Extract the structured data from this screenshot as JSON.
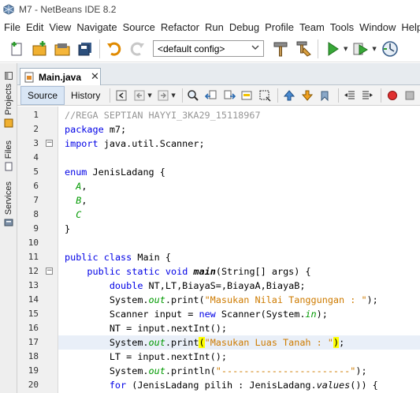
{
  "window": {
    "title": "M7 - NetBeans IDE 8.2"
  },
  "menu": [
    "File",
    "Edit",
    "View",
    "Navigate",
    "Source",
    "Refactor",
    "Run",
    "Debug",
    "Profile",
    "Team",
    "Tools",
    "Window",
    "Help"
  ],
  "toolbar": {
    "config_value": "<default config>"
  },
  "sidebar": {
    "tabs": [
      "Projects",
      "Files",
      "Services"
    ]
  },
  "editor": {
    "file_tab": "Main.java",
    "view_tabs": [
      "Source",
      "History"
    ],
    "line_numbers": [
      "1",
      "2",
      "3",
      "4",
      "5",
      "6",
      "7",
      "8",
      "9",
      "10",
      "11",
      "12",
      "13",
      "14",
      "15",
      "16",
      "17",
      "18",
      "19",
      "20"
    ],
    "lines": [
      "//REGA SEPTIAN HAYYI_3KA29_15118967",
      "package m7;",
      "import java.util.Scanner;",
      "",
      "enum JenisLadang {",
      "  A,",
      "  B,",
      "  C",
      "}",
      "",
      "public class Main {",
      "    public static void main(String[] args) {",
      "        double NT,LT,BiayaS=0,BiayaA,BiayaB;",
      "        System.out.print(\"Masukan Nilai Tanggungan : \");",
      "        Scanner input = new Scanner(System.in);",
      "        NT = input.nextInt();",
      "        System.out.print(\"Masukan Luas Tanah : \");",
      "        LT = input.nextInt();",
      "        System.out.println(\"-----------------------\");",
      "        for (JenisLadang pilih : JenisLadang.values()) {"
    ],
    "current_line": 17
  },
  "colors": {
    "keyword": "#0000e6",
    "comment": "#969696",
    "string": "#ce7b00",
    "field": "#009900",
    "current_line": "#e9eff8"
  },
  "icons": [
    "new-file-icon",
    "new-project-icon",
    "open-project-icon",
    "save-all-icon",
    "undo-icon",
    "redo-icon",
    "build-icon",
    "clean-build-icon",
    "run-icon",
    "debug-icon",
    "profile-icon"
  ]
}
